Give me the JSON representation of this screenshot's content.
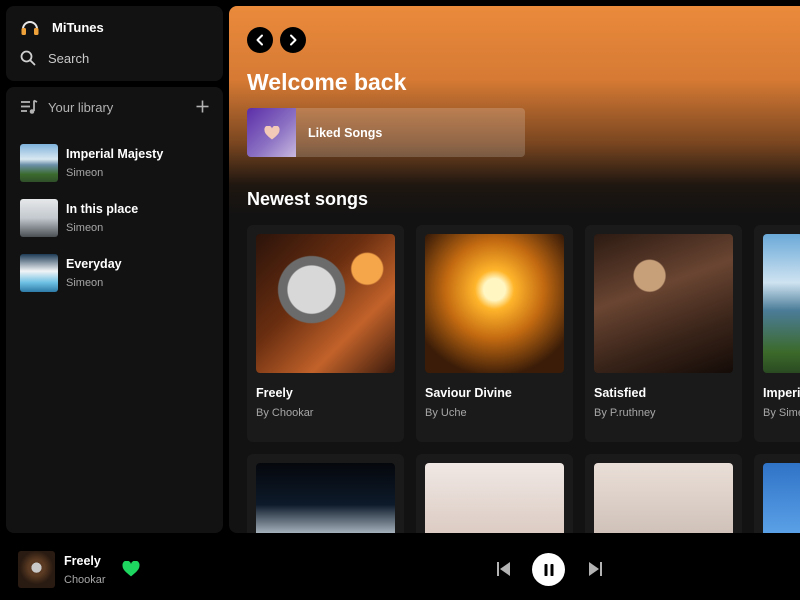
{
  "app": {
    "name": "MiTunes"
  },
  "sidebar": {
    "search_label": "Search",
    "library_title": "Your library",
    "items": [
      {
        "title": "Imperial Majesty",
        "artist": "Simeon",
        "art": "art-lib1"
      },
      {
        "title": "In this place",
        "artist": "Simeon",
        "art": "art-lib2"
      },
      {
        "title": "Everyday",
        "artist": "Simeon",
        "art": "art-lib3"
      }
    ]
  },
  "main": {
    "greeting": "Welcome back",
    "liked_songs_label": "Liked Songs",
    "section_title": "Newest songs",
    "cards": [
      {
        "title": "Freely",
        "artist": "By Chookar",
        "art": "art-freely"
      },
      {
        "title": "Saviour Divine",
        "artist": "By Uche",
        "art": "art-saviour"
      },
      {
        "title": "Satisfied",
        "artist": "By P.ruthney",
        "art": "art-satisfied"
      },
      {
        "title": "Imperial Majesty",
        "artist": "By Simeon",
        "art": "art-imperial"
      },
      {
        "title": "",
        "artist": "",
        "art": "art-earth"
      },
      {
        "title": "",
        "artist": "",
        "art": "art-pray"
      },
      {
        "title": "",
        "artist": "",
        "art": "art-mountain"
      },
      {
        "title": "",
        "artist": "",
        "art": "art-blue"
      }
    ]
  },
  "player": {
    "title": "Freely",
    "artist": "Chookar",
    "liked": true,
    "state": "playing"
  },
  "colors": {
    "accent_green": "#1ed760",
    "header_gradient_top": "#ea8a3b",
    "surface": "#121212"
  }
}
